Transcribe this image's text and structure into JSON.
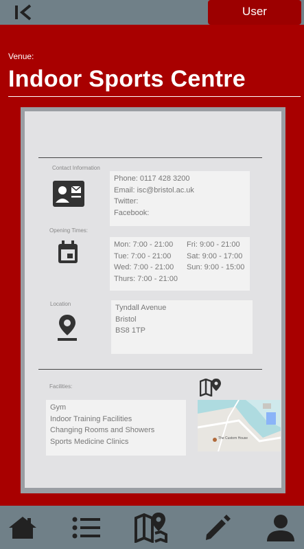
{
  "header": {
    "user_label": "User"
  },
  "venue": {
    "label": "Venue:",
    "name": "Indoor Sports Centre"
  },
  "contact": {
    "section_label": "Contact Information",
    "phone": "Phone:  0117 428 3200",
    "email": "Email: isc@bristol.ac.uk",
    "twitter": "Twitter:",
    "facebook": "Facebook:"
  },
  "opening": {
    "section_label": "Opening Times:",
    "rows": [
      {
        "left": "Mon: 7:00 - 21:00",
        "right": "Fri:   9:00 - 21:00"
      },
      {
        "left": "Tue:  7:00 - 21:00",
        "right": "Sat:  9:00 - 17:00"
      },
      {
        "left": "Wed: 7:00 - 21:00",
        "right": "Sun: 9:00 - 15:00"
      },
      {
        "left": "Thurs: 7:00 - 21:00",
        "right": ""
      }
    ]
  },
  "location": {
    "section_label": "Location",
    "lines": [
      "Tyndall Avenue",
      "Bristol",
      "BS8 1TP"
    ]
  },
  "facilities": {
    "section_label": "Facilities:",
    "items": [
      "Gym",
      "Indoor Training Facilities",
      "Changing Rooms and Showers",
      "Sports Medicine Clinics"
    ]
  },
  "map": {
    "place_label": "The Custom House"
  },
  "nav": [
    "home-icon",
    "list-icon",
    "map-icon",
    "pencil-icon",
    "person-icon"
  ],
  "colors": {
    "brand_red": "#a80000",
    "bar_grey": "#708088",
    "user_button": "#9c0000"
  }
}
